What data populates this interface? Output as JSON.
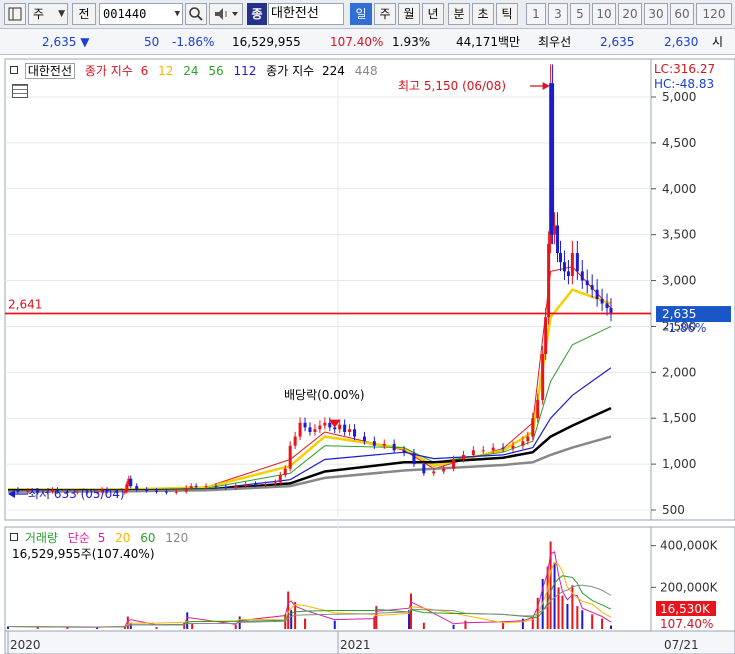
{
  "toolbar": {
    "market": "주",
    "jeon_label": "전",
    "stock_code": "001440",
    "name_prefix": "종",
    "stock_name": "대한전선",
    "periods": [
      "일",
      "주",
      "월",
      "년",
      "분",
      "초",
      "틱"
    ],
    "active_period": "일",
    "intervals": [
      "1",
      "3",
      "5",
      "10",
      "20",
      "30",
      "60",
      "120"
    ]
  },
  "pricebar": {
    "price": "2,635",
    "direction": "▼",
    "change": "50",
    "change_pct": "-1.86%",
    "volume": "16,529,955",
    "volume_ratio": "107.40%",
    "turnover": "1.93%",
    "amount": "44,171백만",
    "best_ask_label": "최우선",
    "best_ask": "2,635",
    "best_bid": "2,630",
    "trailing": "시"
  },
  "price_legend": {
    "name": "대한전선",
    "ma_label": "종가 지수",
    "ma_periods": [
      "6",
      "12",
      "24",
      "56",
      "112"
    ],
    "ma_colors": [
      "#e8141c",
      "#f5b800",
      "#2ca02c",
      "#1c1ccf",
      "#000000"
    ],
    "ma2_label": "종가 지수",
    "ma2_periods": [
      "224",
      "448"
    ],
    "ma2_colors": [
      "#000000",
      "#888888"
    ]
  },
  "lc_label": "LC:316.27",
  "hc_label": "HC:-48.83",
  "volume_legend": {
    "title": "거래량",
    "ma_label": "단순",
    "ma_periods": [
      "5",
      "20",
      "60",
      "120"
    ],
    "ma_colors": [
      "#d81ea0",
      "#f5b800",
      "#2ca02c",
      "#888888"
    ],
    "summary": "16,529,955주(107.40%)"
  },
  "chart_data": {
    "type": "candlestick",
    "y_ticks": [
      "5,000",
      "4,500",
      "4,000",
      "3,500",
      "3,000",
      "2,500",
      "2,000",
      "1,500",
      "1,000",
      "500"
    ],
    "y_tick_values": [
      5000,
      4500,
      4000,
      3500,
      3000,
      2500,
      2000,
      1500,
      1000,
      500
    ],
    "ylim": [
      500,
      5000
    ],
    "x_ticks": [
      "2020",
      "2021",
      "07/21"
    ],
    "horizontal_line": {
      "value": 2641,
      "label": "2,641"
    },
    "current_price": {
      "value": 2635,
      "label": "2,635",
      "change_label": "-1.86%"
    },
    "high_annotation": {
      "value": 5150,
      "label": "최고 5,150 (06/08)"
    },
    "low_annotation": {
      "value": 633,
      "label": "최저 633 (05/04)"
    },
    "event_annotation": {
      "value": 1420,
      "label": "배당락(0.00%)"
    },
    "series": [
      {
        "name": "종가",
        "points": [
          [
            0,
            720
          ],
          [
            10,
            700
          ],
          [
            20,
            710
          ],
          [
            30,
            690
          ],
          [
            40,
            700
          ],
          [
            45,
            720
          ],
          [
            50,
            700
          ],
          [
            60,
            690
          ],
          [
            70,
            700
          ],
          [
            80,
            690
          ],
          [
            90,
            700
          ],
          [
            95,
            720
          ],
          [
            100,
            700
          ],
          [
            110,
            690
          ],
          [
            118,
            700
          ],
          [
            120,
            780
          ],
          [
            122,
            840
          ],
          [
            124,
            760
          ],
          [
            130,
            720
          ],
          [
            140,
            710
          ],
          [
            150,
            700
          ],
          [
            160,
            690
          ],
          [
            170,
            700
          ],
          [
            180,
            740
          ],
          [
            185,
            760
          ],
          [
            190,
            750
          ],
          [
            200,
            760
          ],
          [
            210,
            750
          ],
          [
            220,
            740
          ],
          [
            230,
            760
          ],
          [
            240,
            780
          ],
          [
            250,
            770
          ],
          [
            260,
            780
          ],
          [
            270,
            800
          ],
          [
            275,
            880
          ],
          [
            280,
            950
          ],
          [
            285,
            1200
          ],
          [
            290,
            1300
          ],
          [
            295,
            1450
          ],
          [
            300,
            1400
          ],
          [
            305,
            1350
          ],
          [
            310,
            1380
          ],
          [
            315,
            1420
          ],
          [
            320,
            1450
          ],
          [
            325,
            1400
          ],
          [
            330,
            1380
          ],
          [
            335,
            1430
          ],
          [
            340,
            1350
          ],
          [
            345,
            1380
          ],
          [
            350,
            1300
          ],
          [
            360,
            1250
          ],
          [
            370,
            1200
          ],
          [
            380,
            1220
          ],
          [
            390,
            1150
          ],
          [
            400,
            1120
          ],
          [
            410,
            1000
          ],
          [
            420,
            900
          ],
          [
            430,
            920
          ],
          [
            440,
            950
          ],
          [
            450,
            1050
          ],
          [
            460,
            1100
          ],
          [
            470,
            1150
          ],
          [
            480,
            1150
          ],
          [
            490,
            1180
          ],
          [
            500,
            1170
          ],
          [
            510,
            1200
          ],
          [
            520,
            1250
          ],
          [
            525,
            1300
          ],
          [
            530,
            1500
          ],
          [
            535,
            1700
          ],
          [
            540,
            2200
          ],
          [
            543,
            2600
          ],
          [
            546,
            3400
          ],
          [
            548,
            5150
          ],
          [
            550,
            3500
          ],
          [
            552,
            3600
          ],
          [
            555,
            3300
          ],
          [
            558,
            3200
          ],
          [
            562,
            3100
          ],
          [
            566,
            3050
          ],
          [
            570,
            3300
          ],
          [
            575,
            3100
          ],
          [
            580,
            3000
          ],
          [
            585,
            2950
          ],
          [
            590,
            2900
          ],
          [
            595,
            2800
          ],
          [
            600,
            2750
          ],
          [
            605,
            2700
          ],
          [
            609,
            2635
          ]
        ]
      },
      {
        "name": "종가 지수 6",
        "points": [
          [
            0,
            725
          ],
          [
            120,
            730
          ],
          [
            200,
            750
          ],
          [
            285,
            1050
          ],
          [
            320,
            1350
          ],
          [
            400,
            1150
          ],
          [
            430,
            950
          ],
          [
            500,
            1170
          ],
          [
            530,
            1450
          ],
          [
            548,
            3100
          ],
          [
            570,
            3150
          ],
          [
            609,
            2700
          ]
        ]
      },
      {
        "name": "종가 지수 12",
        "points": [
          [
            0,
            725
          ],
          [
            120,
            725
          ],
          [
            200,
            745
          ],
          [
            285,
            980
          ],
          [
            320,
            1300
          ],
          [
            400,
            1170
          ],
          [
            430,
            980
          ],
          [
            500,
            1150
          ],
          [
            530,
            1350
          ],
          [
            548,
            2600
          ],
          [
            570,
            2900
          ],
          [
            609,
            2750
          ]
        ]
      },
      {
        "name": "종가 지수 24",
        "points": [
          [
            0,
            725
          ],
          [
            120,
            720
          ],
          [
            200,
            735
          ],
          [
            285,
            900
          ],
          [
            320,
            1200
          ],
          [
            400,
            1180
          ],
          [
            430,
            1020
          ],
          [
            500,
            1130
          ],
          [
            530,
            1250
          ],
          [
            548,
            1900
          ],
          [
            570,
            2300
          ],
          [
            609,
            2500
          ]
        ]
      },
      {
        "name": "종가 지수 56",
        "points": [
          [
            0,
            720
          ],
          [
            120,
            715
          ],
          [
            200,
            725
          ],
          [
            285,
            830
          ],
          [
            320,
            1050
          ],
          [
            400,
            1130
          ],
          [
            430,
            1060
          ],
          [
            500,
            1100
          ],
          [
            530,
            1180
          ],
          [
            548,
            1500
          ],
          [
            570,
            1750
          ],
          [
            609,
            2050
          ]
        ]
      },
      {
        "name": "종가 지수 112",
        "points": [
          [
            0,
            715
          ],
          [
            120,
            712
          ],
          [
            200,
            720
          ],
          [
            285,
            790
          ],
          [
            320,
            920
          ],
          [
            400,
            1020
          ],
          [
            430,
            1020
          ],
          [
            500,
            1070
          ],
          [
            530,
            1130
          ],
          [
            548,
            1300
          ],
          [
            570,
            1420
          ],
          [
            609,
            1610
          ]
        ]
      },
      {
        "name": "종가 지수 224",
        "points": [
          [
            0,
            700
          ],
          [
            120,
            705
          ],
          [
            200,
            715
          ],
          [
            285,
            760
          ],
          [
            320,
            850
          ],
          [
            400,
            930
          ],
          [
            430,
            950
          ],
          [
            500,
            990
          ],
          [
            530,
            1020
          ],
          [
            548,
            1100
          ],
          [
            570,
            1180
          ],
          [
            609,
            1300
          ]
        ]
      }
    ],
    "volume_panel": {
      "y_ticks": [
        "400,000K",
        "200,000K"
      ],
      "y_tick_values": [
        400000,
        200000
      ],
      "ylim": [
        0,
        480000
      ],
      "current_label": "16,530K",
      "current_pct_label": "107.40%",
      "bars": [
        [
          0,
          12000
        ],
        [
          30,
          10000
        ],
        [
          60,
          8000
        ],
        [
          90,
          9000
        ],
        [
          118,
          15000
        ],
        [
          121,
          60000
        ],
        [
          124,
          30000
        ],
        [
          150,
          9000
        ],
        [
          178,
          30000
        ],
        [
          181,
          80000
        ],
        [
          186,
          25000
        ],
        [
          230,
          20000
        ],
        [
          234,
          60000
        ],
        [
          280,
          70000
        ],
        [
          283,
          180000
        ],
        [
          286,
          90000
        ],
        [
          290,
          130000
        ],
        [
          300,
          50000
        ],
        [
          330,
          40000
        ],
        [
          370,
          60000
        ],
        [
          372,
          110000
        ],
        [
          405,
          90000
        ],
        [
          407,
          170000
        ],
        [
          420,
          30000
        ],
        [
          450,
          20000
        ],
        [
          462,
          40000
        ],
        [
          500,
          30000
        ],
        [
          520,
          50000
        ],
        [
          530,
          60000
        ],
        [
          535,
          150000
        ],
        [
          540,
          240000
        ],
        [
          545,
          300000
        ],
        [
          548,
          420000
        ],
        [
          552,
          320000
        ],
        [
          556,
          200000
        ],
        [
          560,
          160000
        ],
        [
          565,
          120000
        ],
        [
          570,
          210000
        ],
        [
          575,
          110000
        ],
        [
          580,
          90000
        ],
        [
          590,
          70000
        ],
        [
          600,
          50000
        ],
        [
          609,
          16530
        ]
      ]
    }
  }
}
